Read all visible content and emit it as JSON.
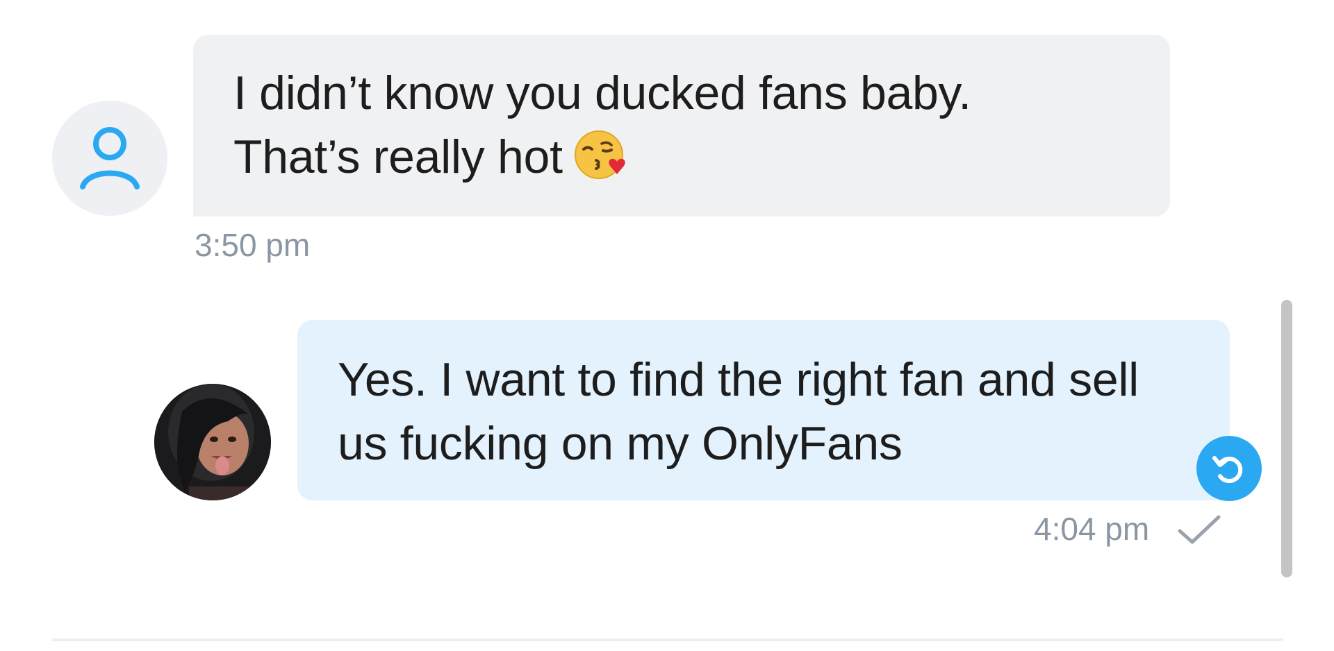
{
  "messages": [
    {
      "direction": "incoming",
      "lines": [
        "I didn’t know you ducked fans baby.",
        "That’s really hot"
      ],
      "emoji": "face-blowing-a-kiss",
      "time": "3:50 pm",
      "avatar": "user-placeholder-icon"
    },
    {
      "direction": "outgoing",
      "lines": [
        "Yes. I want to find the right fan and sell",
        "us fucking on my OnlyFans"
      ],
      "time": "4:04 pm",
      "status": "sent-checkmark",
      "avatar": "profile-photo"
    }
  ],
  "colors": {
    "incoming_bubble": "#f0f1f3",
    "outgoing_bubble": "#e3f2fc",
    "accent": "#2aa8f2",
    "timestamp": "#8a96a3"
  }
}
